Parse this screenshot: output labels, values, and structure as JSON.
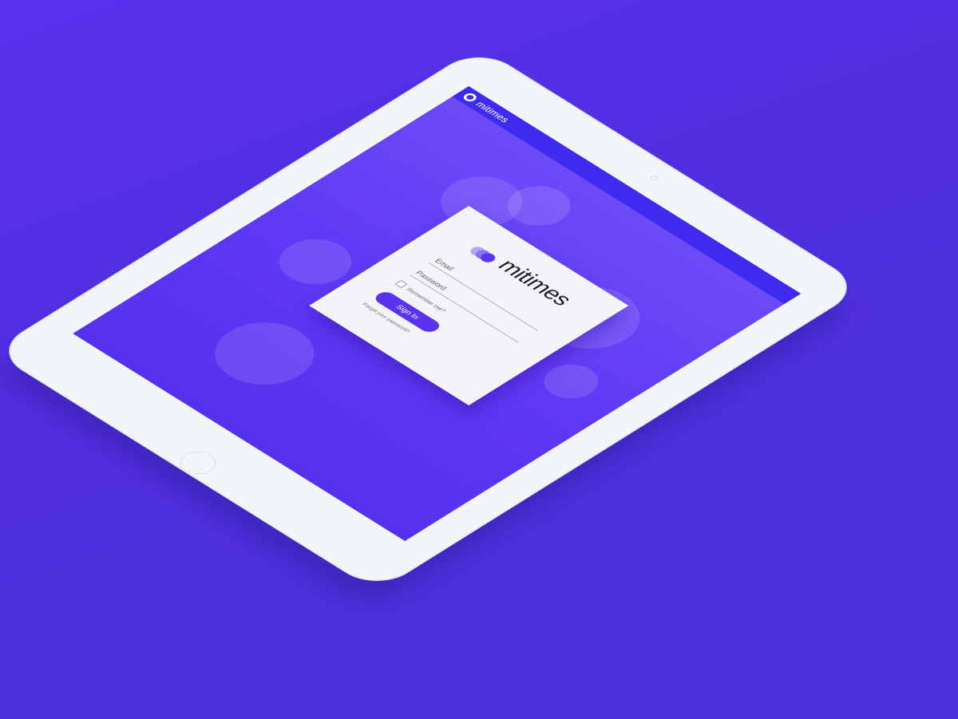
{
  "app": {
    "name": "mitimes"
  },
  "topbar": {
    "title": "mitimes",
    "logo_icon": "mitimes-logo-icon"
  },
  "login": {
    "logo_text": "mitimes",
    "email_label": "Email",
    "password_label": "Password",
    "remember_label": "Remember me?",
    "signin_label": "Sign In",
    "forgot_label": "Forgot your password?"
  },
  "colors": {
    "background": "#5233e4",
    "screen": "#6446f6",
    "topbar": "#3f2bf0",
    "button": "#5a33ef",
    "device": "#f3f6f8",
    "card": "#f2f4f7"
  }
}
